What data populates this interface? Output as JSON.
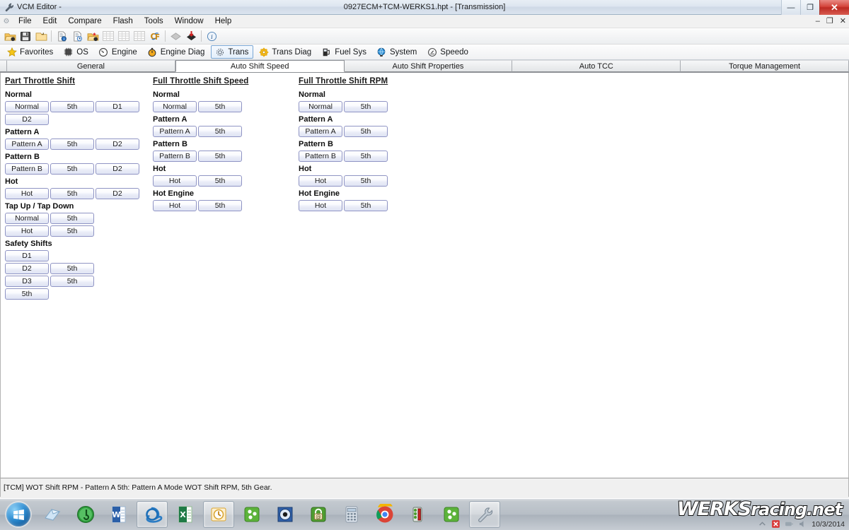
{
  "titlebar": {
    "app_icon": "wrench-icon",
    "app_title": "VCM Editor -",
    "document_title": "0927ECM+TCM-WERKS1.hpt - [Transmission]",
    "minimize": "—",
    "maximize": "❐",
    "close": "✕"
  },
  "menubar": {
    "gear_icon": "gear-icon",
    "items": [
      "File",
      "Edit",
      "Compare",
      "Flash",
      "Tools",
      "Window",
      "Help"
    ],
    "mdi": [
      "–",
      "❐",
      "✕"
    ]
  },
  "toolbar": {
    "buttons": [
      {
        "name": "open-folder-icon",
        "glyph": "folder-open"
      },
      {
        "name": "save-icon",
        "glyph": "floppy"
      },
      {
        "name": "save-as-icon",
        "glyph": "folder-arrow"
      },
      {
        "name": "sep",
        "glyph": "sep"
      },
      {
        "name": "file-info-icon",
        "glyph": "file-info"
      },
      {
        "name": "file-history-icon",
        "glyph": "file-clock"
      },
      {
        "name": "open-recent-icon",
        "glyph": "folder-star"
      },
      {
        "name": "table-view-1-icon",
        "glyph": "table-dim"
      },
      {
        "name": "table-view-2-icon",
        "glyph": "table-dim"
      },
      {
        "name": "table-view-3-icon",
        "glyph": "table-dim"
      },
      {
        "name": "units-convert-icon",
        "glyph": "cf"
      },
      {
        "name": "sep2",
        "glyph": "sep"
      },
      {
        "name": "compare-grey-icon",
        "glyph": "diamond-grey"
      },
      {
        "name": "write-vehicle-icon",
        "glyph": "diamond-red"
      },
      {
        "name": "sep3",
        "glyph": "sep"
      },
      {
        "name": "info-icon",
        "glyph": "info"
      }
    ]
  },
  "navbar": {
    "items": [
      {
        "label": "Favorites",
        "icon": "star-icon",
        "active": false
      },
      {
        "label": "OS",
        "icon": "chip-icon",
        "active": false
      },
      {
        "label": "Engine",
        "icon": "gauge-icon",
        "active": false
      },
      {
        "label": "Engine Diag",
        "icon": "stopwatch-icon",
        "active": false
      },
      {
        "label": "Trans",
        "icon": "gear-outline-icon",
        "active": true
      },
      {
        "label": "Trans Diag",
        "icon": "gear-yellow-icon",
        "active": false
      },
      {
        "label": "Fuel Sys",
        "icon": "fuel-pump-icon",
        "active": false
      },
      {
        "label": "System",
        "icon": "globe-icon",
        "active": false
      },
      {
        "label": "Speedo",
        "icon": "speedometer-icon",
        "active": false
      }
    ]
  },
  "tabs": [
    {
      "label": "General",
      "active": false
    },
    {
      "label": "Auto Shift Speed",
      "active": true
    },
    {
      "label": "Auto Shift Properties",
      "active": false
    },
    {
      "label": "Auto TCC",
      "active": false
    },
    {
      "label": "Torque Management",
      "active": false
    }
  ],
  "columns": [
    {
      "title": "Part Throttle Shift",
      "groups": [
        {
          "label": "Normal",
          "rows": [
            [
              "Normal",
              "5th",
              "D1"
            ],
            [
              "D2"
            ]
          ]
        },
        {
          "label": "Pattern A",
          "rows": [
            [
              "Pattern A",
              "5th",
              "D2"
            ]
          ]
        },
        {
          "label": "Pattern B",
          "rows": [
            [
              "Pattern B",
              "5th",
              "D2"
            ]
          ]
        },
        {
          "label": "Hot",
          "rows": [
            [
              "Hot",
              "5th",
              "D2"
            ]
          ]
        },
        {
          "label": "Tap Up / Tap Down",
          "rows": [
            [
              "Normal",
              "5th"
            ],
            [
              "Hot",
              "5th"
            ]
          ]
        },
        {
          "label": "Safety Shifts",
          "rows": [
            [
              "D1"
            ],
            [
              "D2",
              "5th"
            ],
            [
              "D3",
              "5th"
            ],
            [
              "5th"
            ]
          ]
        }
      ]
    },
    {
      "title": "Full Throttle Shift Speed",
      "groups": [
        {
          "label": "Normal",
          "rows": [
            [
              "Normal",
              "5th"
            ]
          ]
        },
        {
          "label": "Pattern A",
          "rows": [
            [
              "Pattern A",
              "5th"
            ]
          ]
        },
        {
          "label": "Pattern B",
          "rows": [
            [
              "Pattern B",
              "5th"
            ]
          ]
        },
        {
          "label": "Hot",
          "rows": [
            [
              "Hot",
              "5th"
            ]
          ]
        },
        {
          "label": "Hot Engine",
          "rows": [
            [
              "Hot",
              "5th"
            ]
          ]
        }
      ]
    },
    {
      "title": "Full Throttle Shift RPM",
      "groups": [
        {
          "label": "Normal",
          "rows": [
            [
              "Normal",
              "5th"
            ]
          ]
        },
        {
          "label": "Pattern A",
          "rows": [
            [
              "Pattern A",
              "5th"
            ]
          ]
        },
        {
          "label": "Pattern B",
          "rows": [
            [
              "Pattern B",
              "5th"
            ]
          ]
        },
        {
          "label": "Hot",
          "rows": [
            [
              "Hot",
              "5th"
            ]
          ]
        },
        {
          "label": "Hot Engine",
          "rows": [
            [
              "Hot",
              "5th"
            ]
          ]
        }
      ]
    }
  ],
  "statusbar": {
    "text": "[TCM] WOT Shift RPM - Pattern A 5th: Pattern A Mode WOT Shift RPM, 5th Gear."
  },
  "taskbar": {
    "start_icon": "windows-orb-icon",
    "items": [
      {
        "name": "notepad-icon",
        "pressed": false
      },
      {
        "name": "media-player-icon",
        "pressed": false
      },
      {
        "name": "word-icon",
        "pressed": false
      },
      {
        "name": "internet-explorer-icon",
        "pressed": true
      },
      {
        "name": "excel-icon",
        "pressed": false
      },
      {
        "name": "outlook-icon",
        "pressed": true
      },
      {
        "name": "green-apps-icon",
        "pressed": false
      },
      {
        "name": "media-classic-icon",
        "pressed": false
      },
      {
        "name": "mail-lock-icon",
        "pressed": false
      },
      {
        "name": "calculator-icon",
        "pressed": false
      },
      {
        "name": "chrome-icon",
        "pressed": false
      },
      {
        "name": "hp-tuners-icon",
        "pressed": false
      },
      {
        "name": "green-apps-2-icon",
        "pressed": false
      },
      {
        "name": "vcm-editor-icon",
        "pressed": true
      }
    ],
    "tray": {
      "show_hidden_icon": "chevron-up-icon",
      "action_center_icon": "flag-error-icon",
      "network_icon": "network-icon",
      "volume_icon": "volume-icon",
      "date": "10/3/2014"
    },
    "watermark": {
      "part1": "WERKS",
      "part2": "racing.net"
    }
  },
  "colors": {
    "accent_blue": "#8f94c4",
    "tab_active_bg": "#ffffff",
    "nav_active_border": "#7aa7d4",
    "close_red": "#d4433a"
  }
}
